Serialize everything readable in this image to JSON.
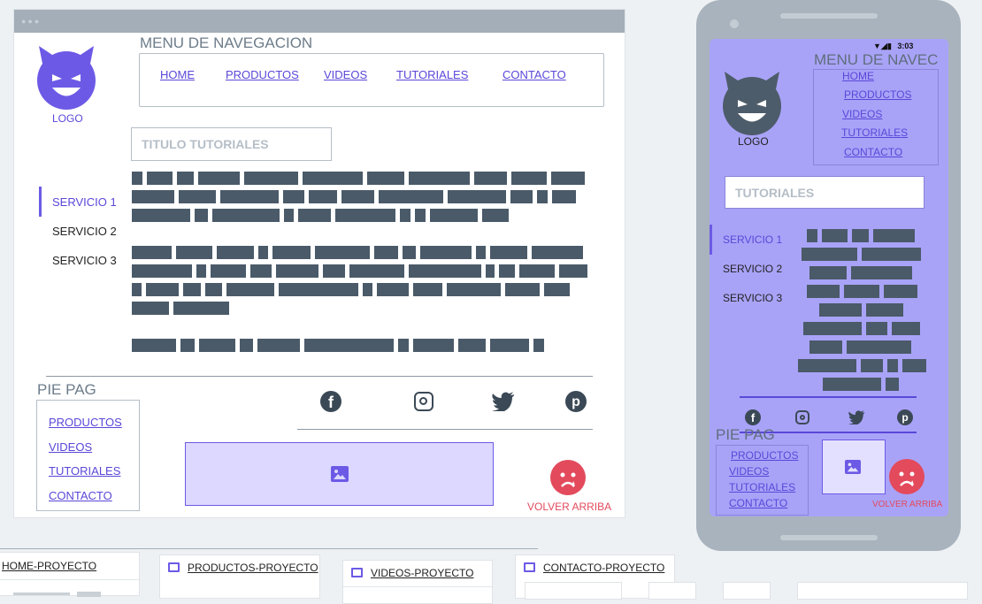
{
  "desktop": {
    "window_dots": "●●●",
    "logo_label": "LOGO",
    "nav_title": "MENU DE NAVEGACION",
    "nav_items": [
      "HOME",
      "PRODUCTOS",
      "VIDEOS",
      "TUTORIALES",
      "CONTACTO"
    ],
    "section_title_placeholder": "TITULO TUTORIALES",
    "side_items": [
      "SERVICIO 1",
      "SERVICIO 2",
      "SERVICIO 3"
    ],
    "footer_title": "PIE PAG",
    "footer_links": [
      "PRODUCTOS",
      "VIDEOS",
      "TUTORIALES",
      "CONTACTO"
    ],
    "social_icons": [
      "facebook-icon",
      "instagram-icon",
      "twitter-icon",
      "pinterest-icon"
    ],
    "back_to_top": "VOLVER ARRIBA"
  },
  "mobile": {
    "status_time": "3:03",
    "logo_label": "LOGO",
    "nav_title": "MENU DE NAVEC",
    "nav_items": [
      "HOME",
      "PRODUCTOS",
      "VIDEOS",
      "TUTORIALES",
      "CONTACTO"
    ],
    "section_title_placeholder": "TUTORIALES",
    "side_items": [
      "SERVICIO 1",
      "SERVICIO 2",
      "SERVICIO 3"
    ],
    "footer_title": "PIE PAG",
    "footer_links": [
      "PRODUCTOS",
      "VIDEOS",
      "TUTORIALES",
      "CONTACTO"
    ],
    "back_to_top": "VOLVER ARRIBA"
  },
  "bottom_tabs": [
    {
      "label": "HOME-PROYECTO"
    },
    {
      "label": "PRODUCTOS-PROYECTO",
      "icon": "presentation-icon"
    },
    {
      "label": "VIDEOS-PROYECTO",
      "icon": "presentation-icon"
    },
    {
      "label": "CONTACTO-PROYECTO",
      "icon": "presentation-icon"
    }
  ],
  "colors": {
    "accent": "#5a47d8",
    "text_block": "#4a5a69",
    "mobile_screen": "#a9a3f8",
    "danger": "#e34a5c"
  }
}
